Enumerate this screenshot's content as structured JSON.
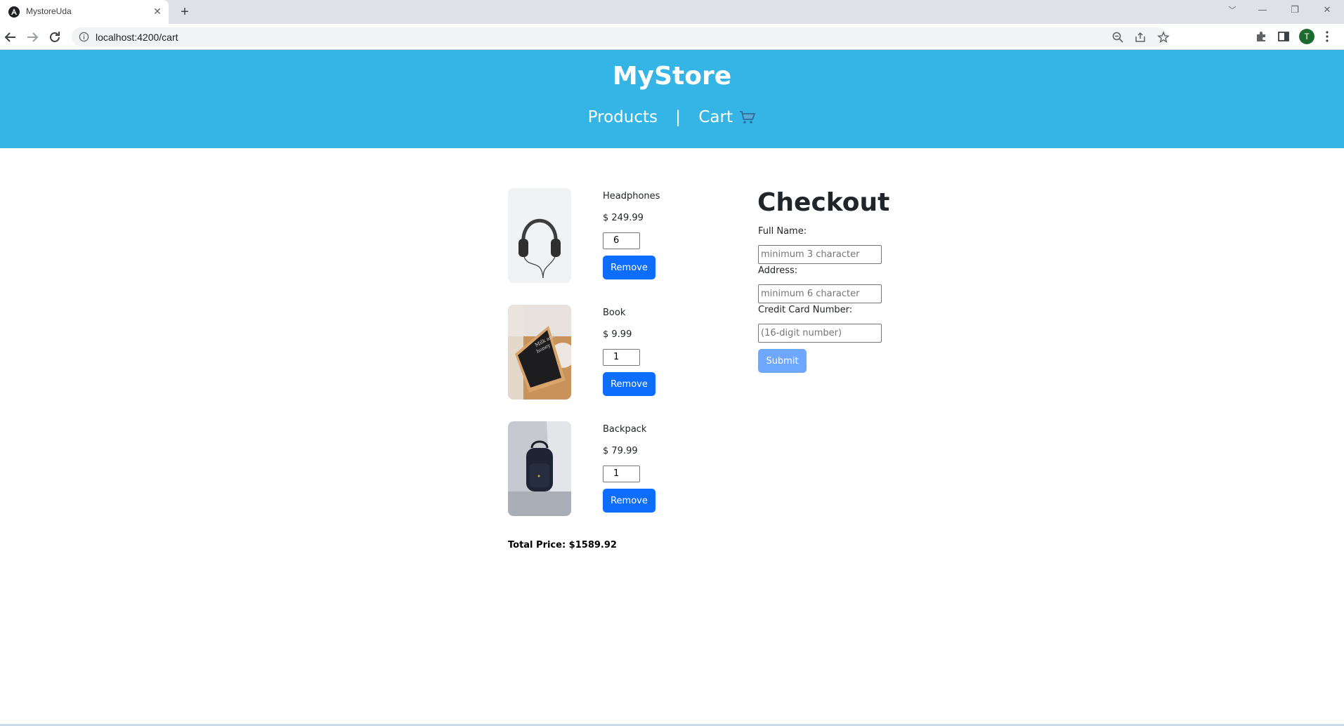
{
  "browser": {
    "tab_title": "MystoreUda",
    "tab_close": "✕",
    "new_tab": "+",
    "url": "localhost:4200/cart",
    "profile_initial": "T",
    "window_controls": [
      "﹀",
      "—",
      "❐",
      "✕"
    ]
  },
  "header": {
    "title": "MyStore",
    "nav": {
      "products": "Products",
      "separator": "|",
      "cart": "Cart"
    }
  },
  "cart": {
    "items": [
      {
        "name": "Headphones",
        "price": "$ 249.99",
        "quantity": "6",
        "remove_label": "Remove",
        "image": "headphones-image"
      },
      {
        "name": "Book",
        "price": "$ 9.99",
        "quantity": "1",
        "remove_label": "Remove",
        "image": "book-image"
      },
      {
        "name": "Backpack",
        "price": "$ 79.99",
        "quantity": "1",
        "remove_label": "Remove",
        "image": "backpack-image"
      }
    ],
    "total_label": "Total Price: $1589.92"
  },
  "checkout": {
    "title": "Checkout",
    "full_name_label": "Full Name:",
    "full_name_placeholder": "minimum 3 character",
    "address_label": "Address:",
    "address_placeholder": "minimum 6 character",
    "card_label": "Credit Card Number:",
    "card_placeholder": "(16-digit number)",
    "submit_label": "Submit"
  },
  "colors": {
    "header_bg": "#35b5e5",
    "primary_button": "#0d6efd",
    "disabled_button": "#6ea8fe"
  }
}
